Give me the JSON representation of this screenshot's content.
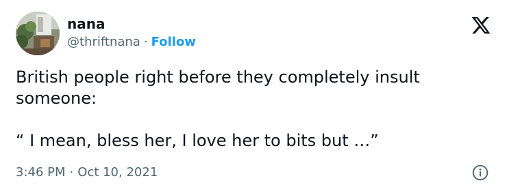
{
  "author": {
    "display_name": "nana",
    "handle": "@thriftnana",
    "separator": "·",
    "follow_label": "Follow",
    "avatar_icon": "avatar-photo-icon"
  },
  "brand": {
    "logo_icon": "x-logo-icon"
  },
  "tweet": {
    "text_line1": "British people right before they completely insult someone:",
    "text_line2": "“ I mean, bless her, I love her to bits but …”"
  },
  "meta": {
    "time": "3:46 PM",
    "separator": "·",
    "date": "Oct 10, 2021",
    "info_icon": "info-icon"
  },
  "colors": {
    "text": "#0f1419",
    "secondary": "#536471",
    "accent": "#1d9bf0",
    "background": "#ffffff"
  }
}
